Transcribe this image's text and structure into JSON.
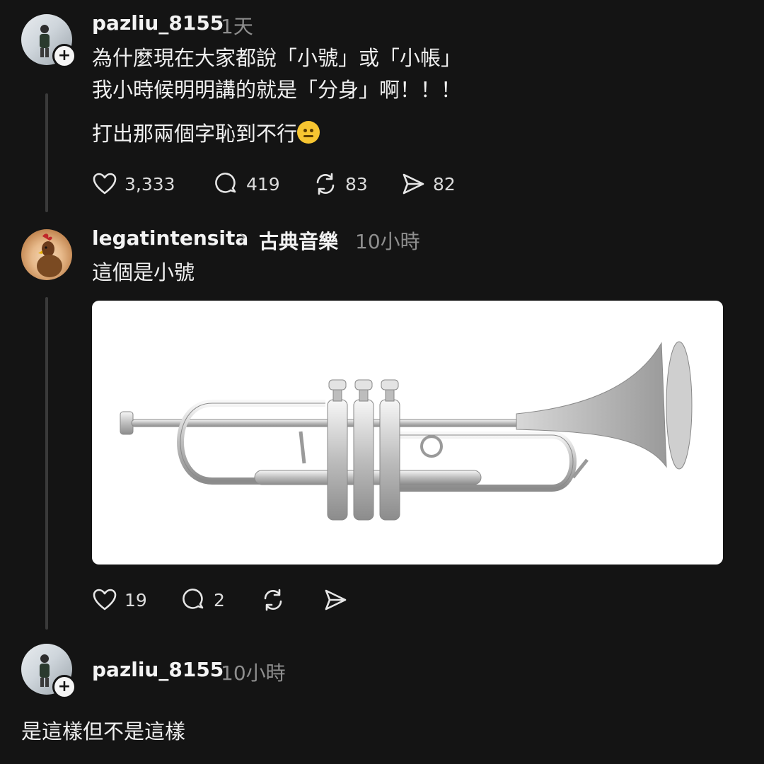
{
  "post1": {
    "username": "pazliu_8155",
    "time": "1天",
    "lines": [
      "為什麼現在大家都說「小號」或「小帳」",
      "我小時候明明講的就是「分身」啊！！！"
    ],
    "line3": "打出那兩個字恥到不行",
    "emoji_icon": "neutral-face-emoji",
    "likes": "3,333",
    "comments": "419",
    "reposts": "83",
    "shares": "82"
  },
  "reply": {
    "username": "legatintensita",
    "topic": "古典音樂",
    "time": "10小時",
    "text": "這個是小號",
    "likes": "19",
    "comments": "2"
  },
  "post3": {
    "username": "pazliu_8155",
    "time": "10小時",
    "text": "是這樣但不是這樣"
  },
  "icons": {
    "heart": "heart-icon",
    "comment": "comment-icon",
    "repost": "repost-icon",
    "share": "send-icon",
    "follow": "plus-icon",
    "chevron": "chevron-right-icon"
  },
  "colors": {
    "background": "#141414",
    "text": "#f3f3f3",
    "muted": "#8e8e8e",
    "thread_line": "#3a3a3a"
  }
}
